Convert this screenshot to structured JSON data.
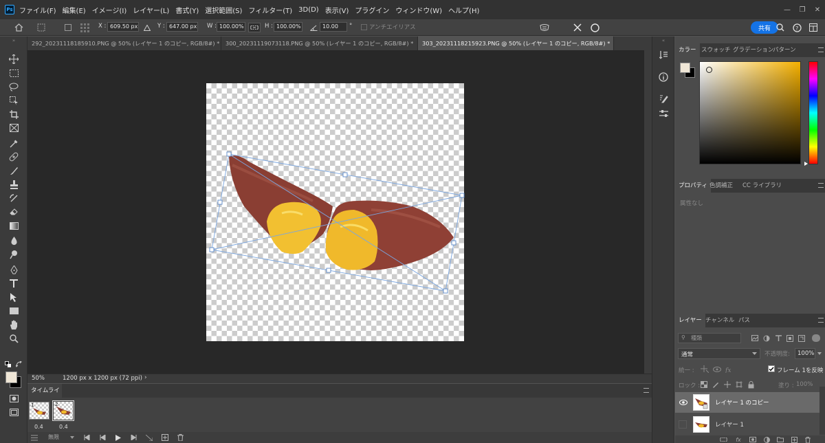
{
  "app": {
    "logo": "Ps"
  },
  "menu": [
    "ファイル(F)",
    "編集(E)",
    "イメージ(I)",
    "レイヤー(L)",
    "書式(Y)",
    "選択範囲(S)",
    "フィルター(T)",
    "3D(D)",
    "表示(V)",
    "プラグイン",
    "ウィンドウ(W)",
    "ヘルプ(H)"
  ],
  "window_controls": {
    "minimize": "—",
    "restore": "❐",
    "close": "✕"
  },
  "options": {
    "x_label": "X :",
    "x_value": "609.50 px",
    "y_label": "Y :",
    "y_value": "647.00 px",
    "w_label": "W :",
    "w_value": "100.00%",
    "h_label": "H :",
    "h_value": "100.00%",
    "angle_value": "10.00",
    "angle_unit": "°",
    "antialias_label": "アンチエイリアス",
    "share_label": "共有"
  },
  "tabs": [
    {
      "label": "292_20231118185910.PNG @ 50% (レイヤー 1 のコピー, RGB/8#) *",
      "close": "×"
    },
    {
      "label": "300_20231119073118.PNG @ 50% (レイヤー 1 のコピー, RGB/8#) *",
      "close": "×"
    },
    {
      "label": "303_20231118215923.PNG @ 50% (レイヤー 1 のコピー, RGB/8#) *",
      "close": "×"
    }
  ],
  "status": {
    "zoom": "50%",
    "doc_info": "1200 px x 1200 px (72 ppi)",
    "arrow": "›"
  },
  "timeline": {
    "title": "タイムライン",
    "frames": [
      {
        "num": "1",
        "delay": "0.4"
      },
      {
        "num": "2",
        "delay": "0.4"
      }
    ],
    "loop": "無限"
  },
  "color_panel": {
    "tabs": [
      "カラー",
      "スウォッチ",
      "グラデーション",
      "パターン"
    ]
  },
  "props_panel": {
    "tabs": [
      "プロパティ",
      "色調補正",
      "CC ライブラリ"
    ],
    "empty_text": "属性なし"
  },
  "layers_panel": {
    "tabs": [
      "レイヤー",
      "チャンネル",
      "パス"
    ],
    "search_placeholder": "種類",
    "blend_mode": "通常",
    "opacity_label": "不透明度:",
    "opacity_value": "100%",
    "unify_label": "統一 :",
    "frame_propagate": "フレーム 1を反映",
    "lock_label": "ロック :",
    "fill_label": "塗り :",
    "fill_value": "100%",
    "layers": [
      {
        "name": "レイヤー 1 のコピー",
        "visible": true,
        "selected": true
      },
      {
        "name": "レイヤー 1",
        "visible": false,
        "selected": false
      }
    ]
  },
  "colors": {
    "accent": "#1473e6",
    "foreground": "#efe6d6",
    "background": "#000000"
  }
}
